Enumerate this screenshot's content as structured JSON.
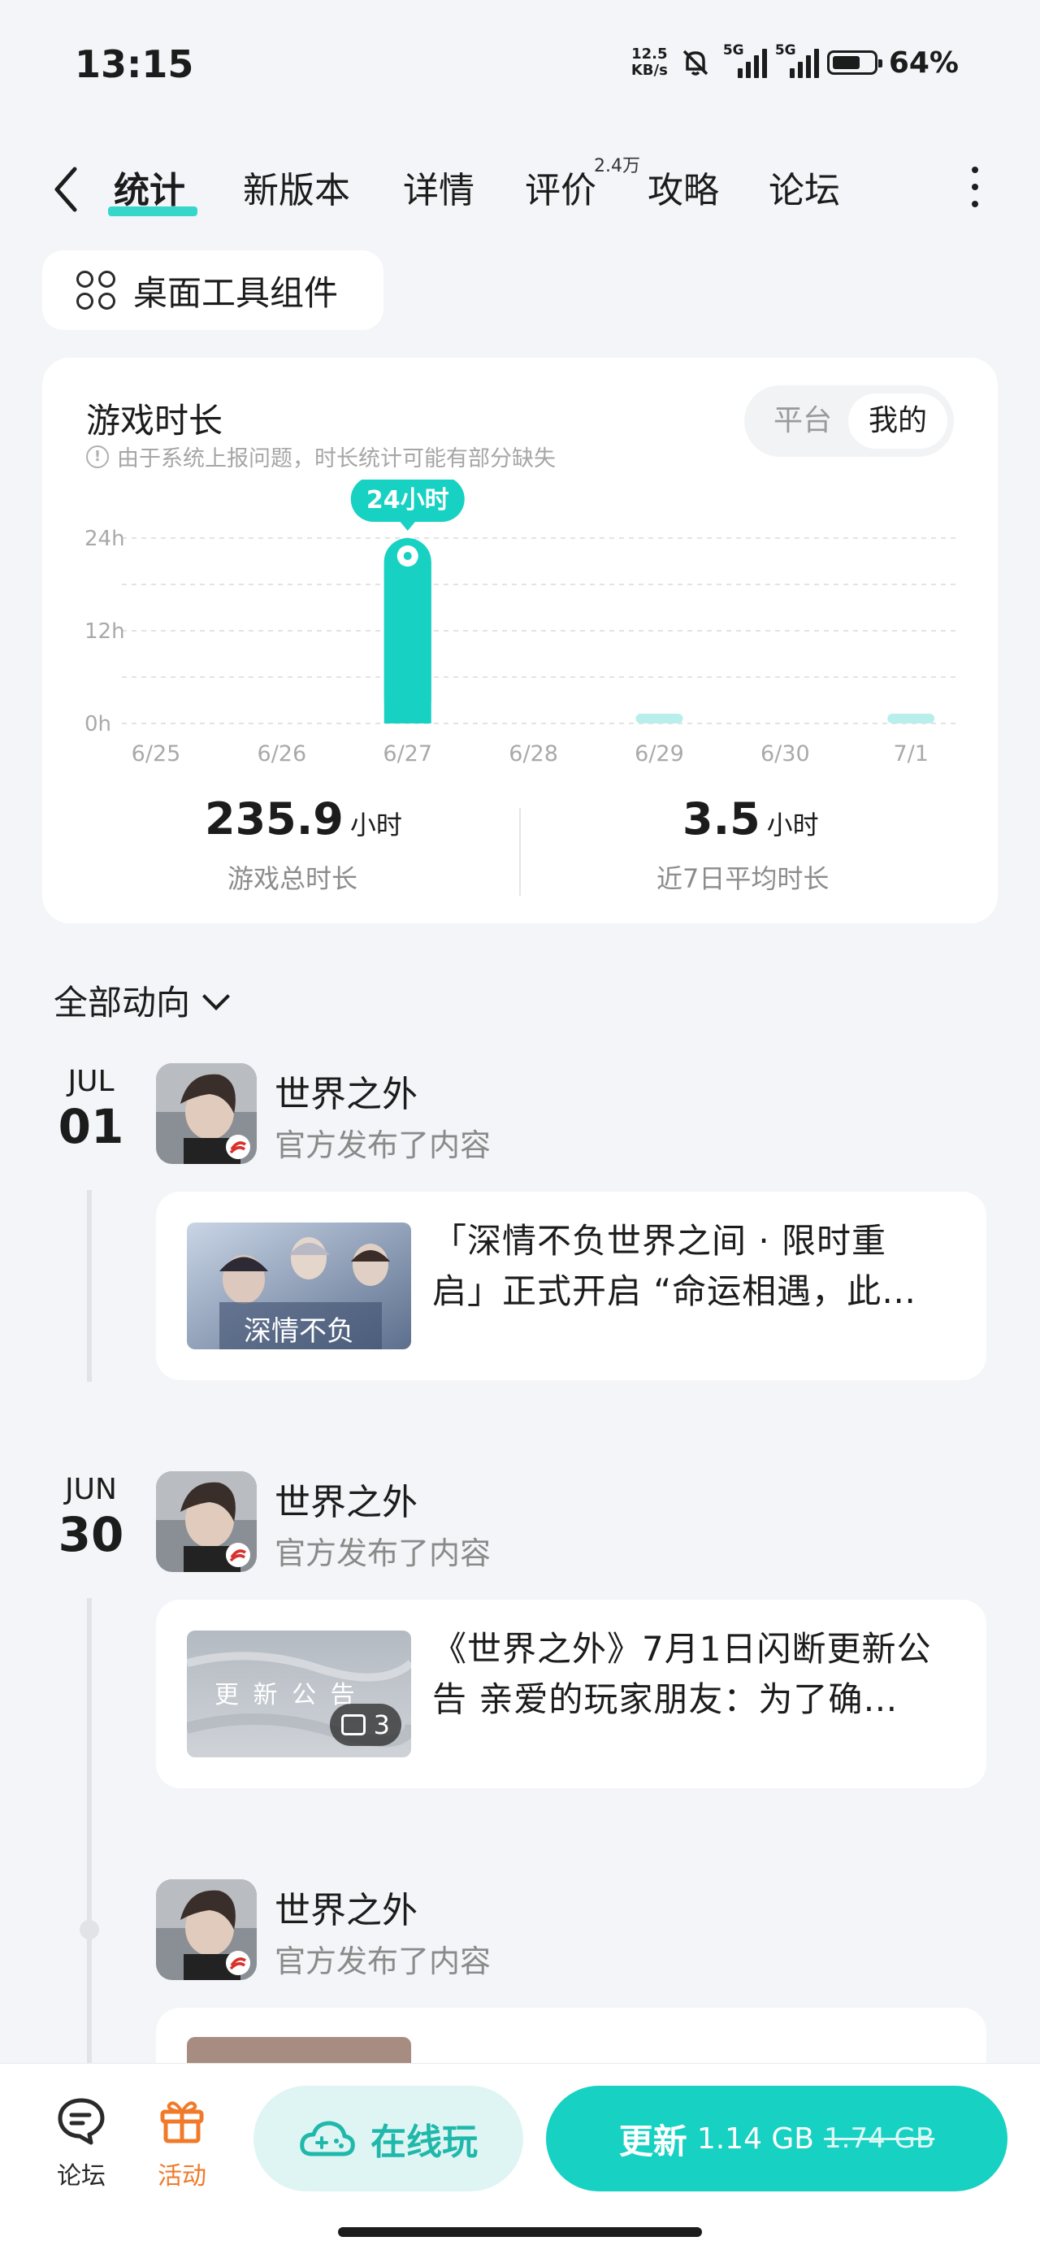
{
  "status_bar": {
    "time": "13:15",
    "net_speed_value": "12.5",
    "net_speed_unit": "KB/s",
    "sim1": "5G",
    "sim2": "5G",
    "battery": "64%"
  },
  "tabs": {
    "items": [
      {
        "label": "统计"
      },
      {
        "label": "新版本"
      },
      {
        "label": "详情"
      },
      {
        "label": "评价"
      },
      {
        "label": "攻略"
      },
      {
        "label": "论坛"
      }
    ],
    "rating_count": "2.4万",
    "active_tab": "统计"
  },
  "widget_button": {
    "label": "桌面工具组件"
  },
  "playtime_card": {
    "title": "游戏时长",
    "note": "由于系统上报问题，时长统计可能有部分缺失",
    "toggle": {
      "platform": "平台",
      "mine": "我的",
      "selected": "我的"
    },
    "total": {
      "value": "235.9",
      "unit": "小时",
      "label": "游戏总时长"
    },
    "avg7": {
      "value": "3.5",
      "unit": "小时",
      "label": "近7日平均时长"
    }
  },
  "chart_data": {
    "type": "bar",
    "categories": [
      "6/25",
      "6/26",
      "6/27",
      "6/28",
      "6/29",
      "6/30",
      "7/1"
    ],
    "values": [
      0,
      0,
      24,
      0,
      0.5,
      0,
      0.5
    ],
    "y_ticks": [
      "24h",
      "12h",
      "0h"
    ],
    "ylim": [
      0,
      24
    ],
    "highlight_index": 2,
    "highlight_label": "24小时",
    "grid": true,
    "color_main": "#17d1c2",
    "color_light": "#b8efeb"
  },
  "feed": {
    "filter_label": "全部动向",
    "entries": [
      {
        "month": "JUL",
        "day": "01",
        "name": "世界之外",
        "sub": "官方发布了内容",
        "post_l1": "「深情不负世界之间 · 限时重",
        "post_l2": "启」正式开启 “命运相遇，此…",
        "thumb_text": "深情不负"
      },
      {
        "month": "JUN",
        "day": "30",
        "name": "世界之外",
        "sub": "官方发布了内容",
        "post_l1": "《世界之外》7月1日闪断更新公",
        "post_l2": "告 亲爱的玩家朋友：为了确…",
        "thumb_text": "更 新 公 告",
        "image_count": "3"
      },
      {
        "name": "世界之外",
        "sub": "官方发布了内容"
      }
    ]
  },
  "bottom_bar": {
    "forum_label": "论坛",
    "activity_label": "活动",
    "play_online_label": "在线玩",
    "update_label": "更新",
    "update_size": "1.14 GB",
    "update_old_size": "1.74 GB"
  }
}
